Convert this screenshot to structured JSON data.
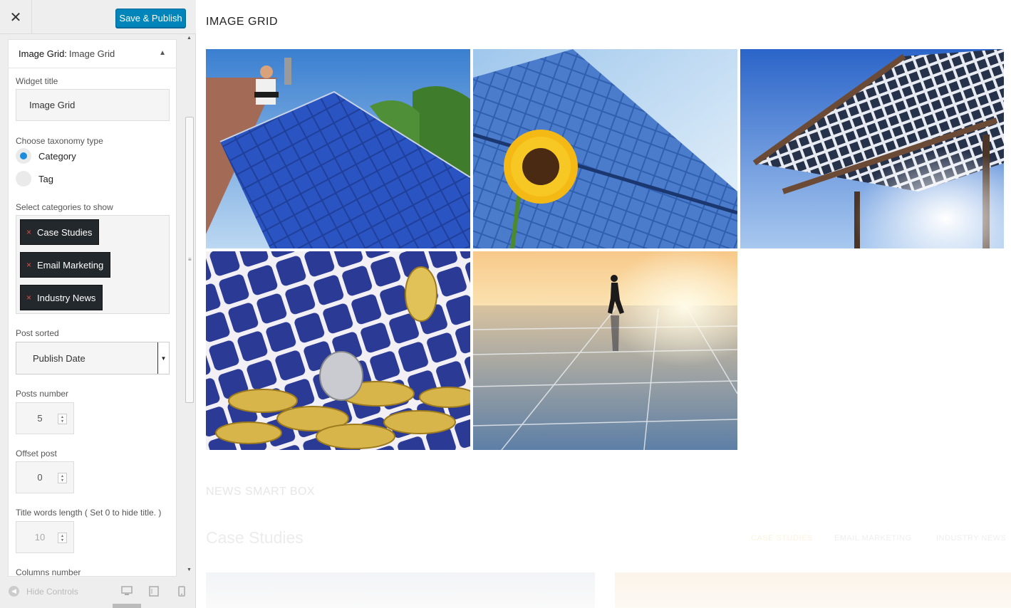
{
  "sidebar": {
    "close_icon": "close-icon",
    "save_label": "Save & Publish",
    "panel": {
      "widget_type": "Image Grid:",
      "widget_name": "Image Grid"
    },
    "widget_title": {
      "label": "Widget title",
      "value": "Image Grid"
    },
    "taxonomy": {
      "label": "Choose taxonomy type",
      "options": [
        {
          "label": "Category",
          "checked": true
        },
        {
          "label": "Tag",
          "checked": false
        }
      ]
    },
    "categories": {
      "label": "Select categories to show",
      "selected": [
        "Case Studies",
        "Email Marketing",
        "Industry News"
      ],
      "remove_glyph": "×"
    },
    "post_sorted": {
      "label": "Post sorted",
      "value": "Publish Date"
    },
    "posts_number": {
      "label": "Posts number",
      "value": "5"
    },
    "offset_post": {
      "label": "Offset post",
      "value": "0"
    },
    "title_words": {
      "label": "Title words length ( Set 0 to hide title. )",
      "value": "10"
    },
    "columns": {
      "label": "Columns number"
    },
    "footer": {
      "hide_controls": "Hide Controls",
      "devices": [
        "desktop-icon",
        "tablet-icon",
        "mobile-icon"
      ]
    }
  },
  "preview": {
    "grid_title": "IMAGE GRID",
    "images": [
      "solar-roof-installer-photo",
      "sunflower-solar-panel-photo",
      "solar-canopy-photo",
      "coins-on-solar-cells-photo",
      "runner-on-solar-field-photo"
    ],
    "news_title": "NEWS SMART BOX",
    "news_category": "Case Studies",
    "news_tabs": [
      "CASE STUDIES",
      "EMAIL MARKETING",
      "INDUSTRY NEWS"
    ]
  },
  "colors": {
    "accent": "#0085ba",
    "radio_checked": "#1e8cdd",
    "tag_bg": "#23282d",
    "tag_remove": "#e14d43"
  }
}
